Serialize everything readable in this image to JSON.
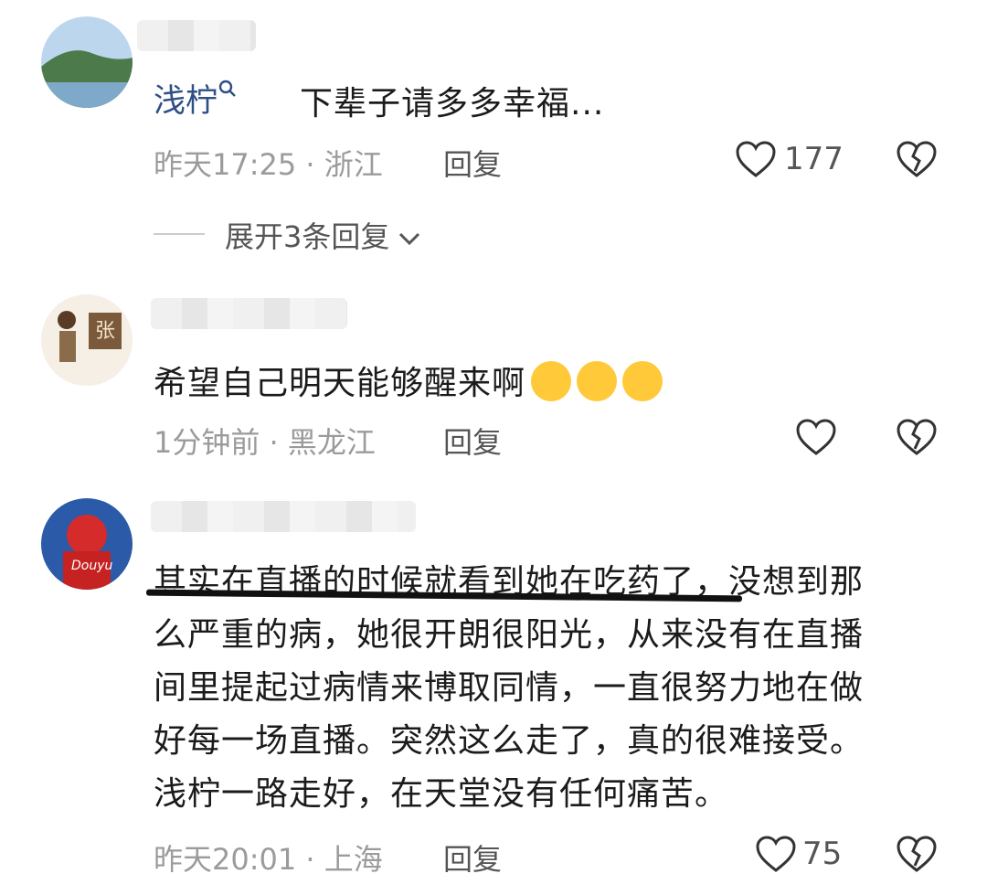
{
  "comments": [
    {
      "name": "浅柠",
      "text": "下辈子请多多幸福...",
      "time": "昨天17:25",
      "location": "浙江",
      "reply_label": "回复",
      "like_count": "177",
      "expand_label": "展开3条回复"
    },
    {
      "text": "希望自己明天能够醒来啊",
      "time": "1分钟前",
      "location": "黑龙江",
      "reply_label": "回复",
      "avatar_text": "张"
    },
    {
      "lines": [
        "其实在直播的时候就看到她在吃药了，没想到那",
        "么严重的病，她很开朗很阳光，从来没有在直播",
        "间里提起过病情来博取同情，一直很努力地在做",
        "好每一场直播。突然这么走了，真的很难接受。",
        "浅柠一路走好，在天堂没有任何痛苦。"
      ],
      "time": "昨天20:01",
      "location": "上海",
      "reply_label": "回复",
      "like_count": "75",
      "avatar_text": "Douyu"
    }
  ],
  "separator": "·",
  "icons": [
    "heart-icon",
    "broken-heart-icon",
    "search-icon",
    "chevron-down-icon",
    "crying-emoji-icon"
  ]
}
